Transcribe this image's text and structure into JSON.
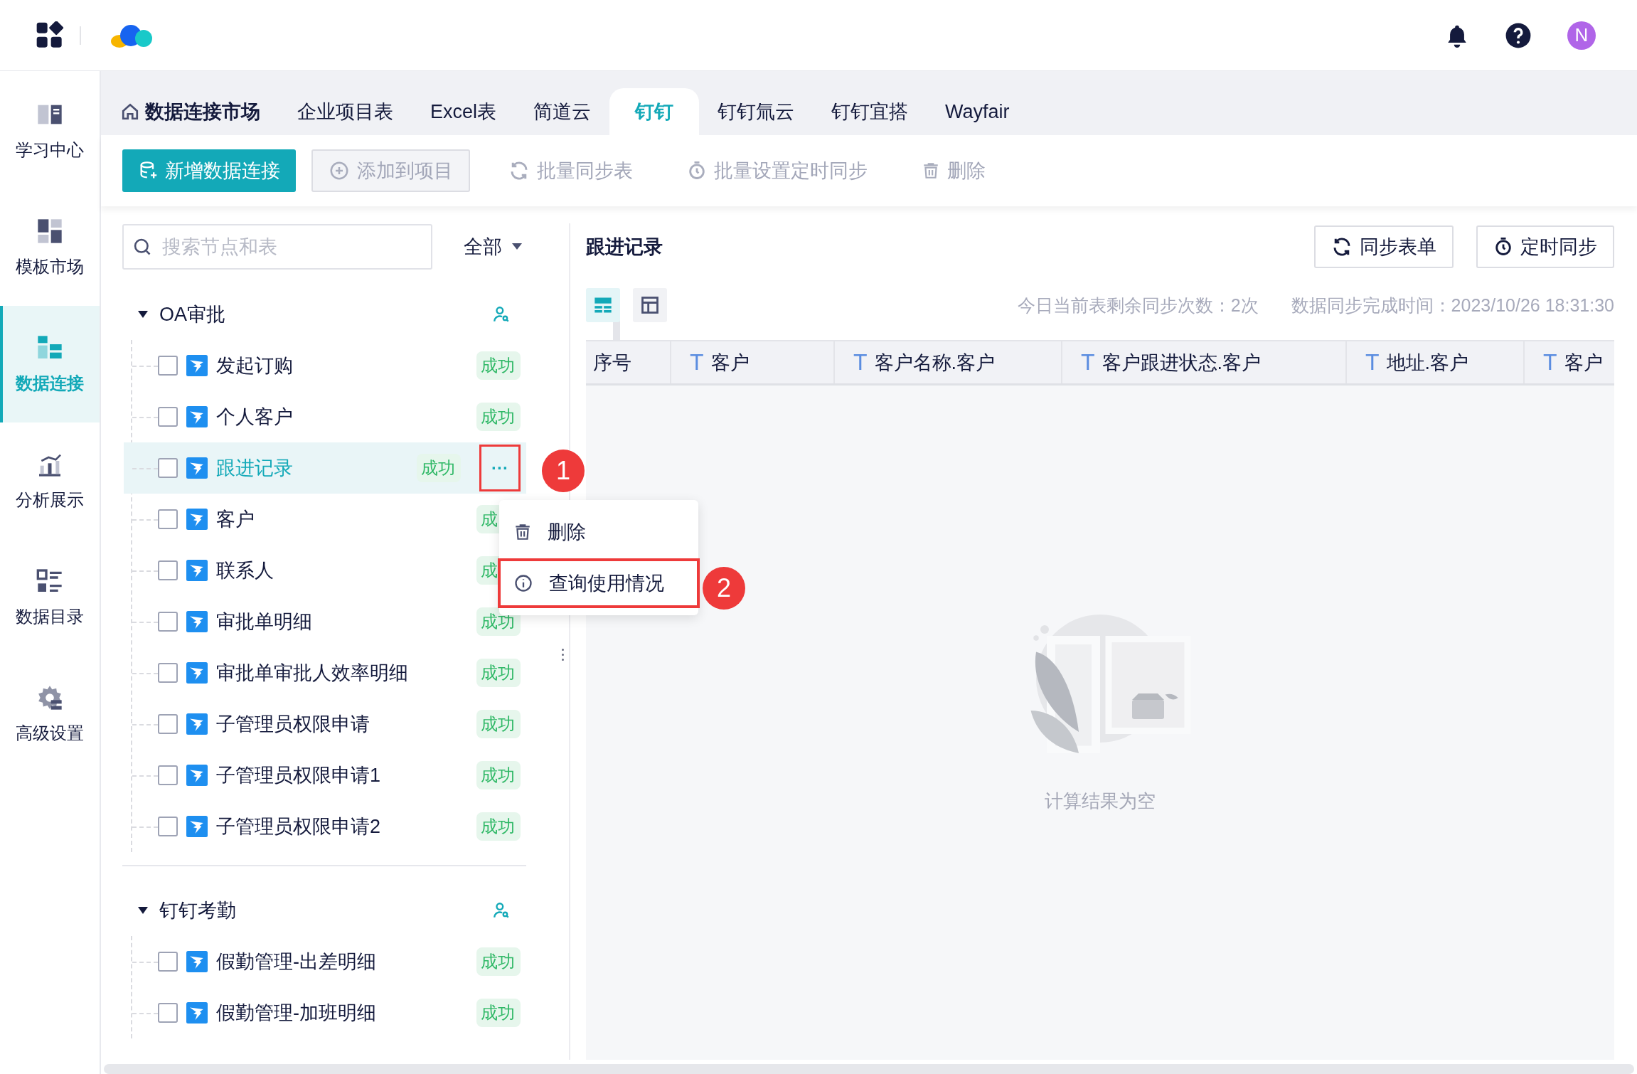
{
  "topbar": {
    "avatar": "N"
  },
  "sidebar": [
    {
      "label": "学习中心",
      "selected": false
    },
    {
      "label": "模板市场",
      "selected": false
    },
    {
      "label": "数据连接",
      "selected": true
    },
    {
      "label": "分析展示",
      "selected": false
    },
    {
      "label": "数据目录",
      "selected": false
    },
    {
      "label": "高级设置",
      "selected": false
    }
  ],
  "tabs": [
    {
      "label": "数据连接市场",
      "kind": "home",
      "selected": false
    },
    {
      "label": "企业项目表",
      "kind": "plain",
      "selected": false
    },
    {
      "label": "Excel表",
      "kind": "plain",
      "selected": false
    },
    {
      "label": "简道云",
      "kind": "plain",
      "selected": false
    },
    {
      "label": "钉钉",
      "kind": "plain",
      "selected": true
    },
    {
      "label": "钉钉氚云",
      "kind": "plain",
      "selected": false
    },
    {
      "label": "钉钉宜搭",
      "kind": "plain",
      "selected": false
    },
    {
      "label": "Wayfair",
      "kind": "plain",
      "selected": false
    }
  ],
  "toolbar": [
    {
      "label": "新增数据连接",
      "kind": "primary",
      "disabled": false
    },
    {
      "label": "添加到项目",
      "kind": "outlined",
      "disabled": true
    },
    {
      "label": "批量同步表",
      "kind": "text",
      "disabled": true
    },
    {
      "label": "批量设置定时同步",
      "kind": "text",
      "disabled": true
    },
    {
      "label": "删除",
      "kind": "text",
      "disabled": true
    }
  ],
  "search": {
    "placeholder": "搜索节点和表"
  },
  "filter": {
    "value": "全部"
  },
  "groups": [
    {
      "name": "OA审批",
      "expanded": true,
      "items": [
        {
          "name": "发起订购",
          "status": "成功",
          "checked": false,
          "selected": false
        },
        {
          "name": "个人客户",
          "status": "成功",
          "checked": false,
          "selected": false
        },
        {
          "name": "跟进记录",
          "status": "成功",
          "checked": false,
          "selected": true
        },
        {
          "name": "客户",
          "status": "成",
          "checked": false,
          "selected": false
        },
        {
          "name": "联系人",
          "status": "成",
          "checked": false,
          "selected": false
        },
        {
          "name": "审批单明细",
          "status": "成功",
          "checked": false,
          "selected": false
        },
        {
          "name": "审批单审批人效率明细",
          "status": "成功",
          "checked": false,
          "selected": false
        },
        {
          "name": "子管理员权限申请",
          "status": "成功",
          "checked": false,
          "selected": false
        },
        {
          "name": "子管理员权限申请1",
          "status": "成功",
          "checked": false,
          "selected": false
        },
        {
          "name": "子管理员权限申请2",
          "status": "成功",
          "checked": false,
          "selected": false
        }
      ]
    },
    {
      "name": "钉钉考勤",
      "expanded": true,
      "items": [
        {
          "name": "假勤管理-出差明细",
          "status": "成功",
          "checked": false,
          "selected": false
        },
        {
          "name": "假勤管理-加班明细",
          "status": "成功",
          "checked": false,
          "selected": false
        }
      ]
    }
  ],
  "more_button": "···",
  "context_menu": {
    "items": [
      {
        "label": "删除",
        "highlighted": false
      },
      {
        "label": "查询使用情况",
        "highlighted": true
      }
    ]
  },
  "annotations": [
    {
      "label": "1"
    },
    {
      "label": "2"
    }
  ],
  "detail": {
    "title": "跟进记录",
    "buttons": [
      {
        "label": "同步表单"
      },
      {
        "label": "定时同步"
      }
    ],
    "view_modes": [
      {
        "kind": "rows",
        "selected": true
      },
      {
        "kind": "grid",
        "selected": false
      }
    ],
    "info": [
      "今日当前表剩余同步次数：2次",
      "数据同步完成时间：2023/10/26 18:31:30"
    ],
    "columns": [
      {
        "label": "序号",
        "kind": "index"
      },
      {
        "label": "客户",
        "kind": "text",
        "type_mark": "T"
      },
      {
        "label": "客户名称.客户",
        "kind": "text",
        "type_mark": "T"
      },
      {
        "label": "客户跟进状态.客户",
        "kind": "text",
        "type_mark": "T"
      },
      {
        "label": "地址.客户",
        "kind": "text",
        "type_mark": "T"
      },
      {
        "label": "客户",
        "kind": "text",
        "type_mark": "T"
      }
    ],
    "empty_text": "计算结果为空"
  }
}
